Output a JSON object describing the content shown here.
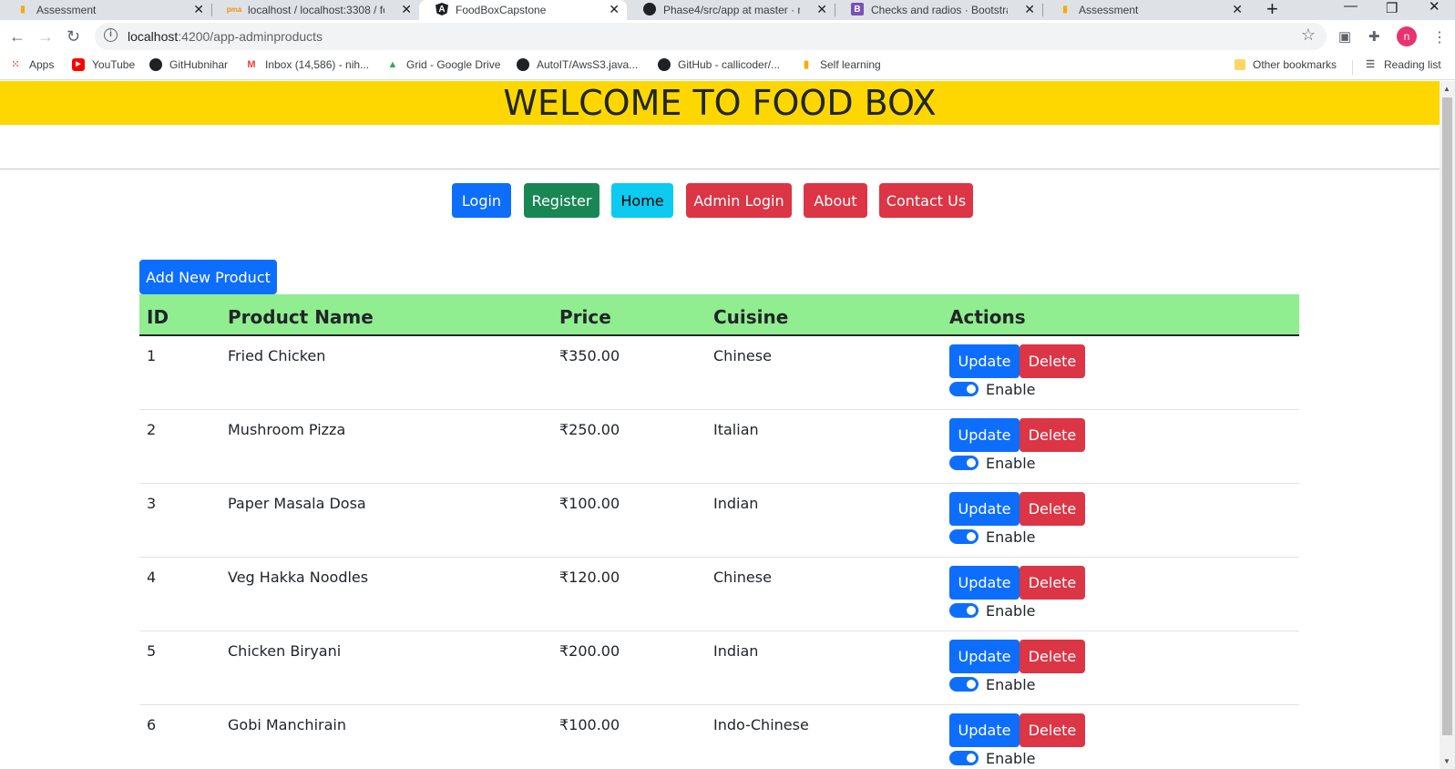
{
  "browser": {
    "tabs": [
      {
        "title": "Assessment",
        "icon": "chart-icon"
      },
      {
        "title": "localhost / localhost:3308 / foo",
        "icon": "pma-icon"
      },
      {
        "title": "FoodBoxCapstone",
        "icon": "angular-icon"
      },
      {
        "title": "Phase4/src/app at master · niha",
        "icon": "github-icon"
      },
      {
        "title": "Checks and radios · Bootstrap v",
        "icon": "bootstrap-icon"
      },
      {
        "title": "Assessment",
        "icon": "chart-icon"
      }
    ],
    "url_host": "localhost",
    "url_rest": ":4200/app-adminproducts",
    "profile_initial": "n",
    "bookmarks": [
      {
        "label": "Apps"
      },
      {
        "label": "YouTube"
      },
      {
        "label": "GitHubnihar"
      },
      {
        "label": "Inbox (14,586) - nih..."
      },
      {
        "label": "Grid - Google Drive"
      },
      {
        "label": "AutoIT/AwsS3.java..."
      },
      {
        "label": "GitHub - callicoder/..."
      },
      {
        "label": "Self learning"
      }
    ],
    "other_bookmarks": "Other bookmarks",
    "reading_list": "Reading list"
  },
  "page": {
    "banner_title": "WELCOME TO FOOD BOX",
    "nav": {
      "login": "Login",
      "register": "Register",
      "home": "Home",
      "admin_login": "Admin Login",
      "about": "About",
      "contact": "Contact Us"
    },
    "add_product": "Add New Product",
    "table": {
      "headers": [
        "ID",
        "Product Name",
        "Price",
        "Cuisine",
        "Actions"
      ],
      "update_label": "Update",
      "delete_label": "Delete",
      "toggle_label": "Enable",
      "rows": [
        {
          "id": "1",
          "name": "Fried Chicken",
          "price": "₹350.00",
          "cuisine": "Chinese",
          "enabled": true
        },
        {
          "id": "2",
          "name": "Mushroom Pizza",
          "price": "₹250.00",
          "cuisine": "Italian",
          "enabled": true
        },
        {
          "id": "3",
          "name": "Paper Masala Dosa",
          "price": "₹100.00",
          "cuisine": "Indian",
          "enabled": true
        },
        {
          "id": "4",
          "name": "Veg Hakka Noodles",
          "price": "₹120.00",
          "cuisine": "Chinese",
          "enabled": true
        },
        {
          "id": "5",
          "name": "Chicken Biryani",
          "price": "₹200.00",
          "cuisine": "Indian",
          "enabled": true
        },
        {
          "id": "6",
          "name": "Gobi Manchirain",
          "price": "₹100.00",
          "cuisine": "Indo-Chinese",
          "enabled": true
        }
      ]
    }
  },
  "colors": {
    "banner": "#ffd700",
    "table_header": "#90ee90",
    "primary": "#0d6efd",
    "success": "#198754",
    "info": "#0dcaf0",
    "danger": "#dc3545"
  }
}
